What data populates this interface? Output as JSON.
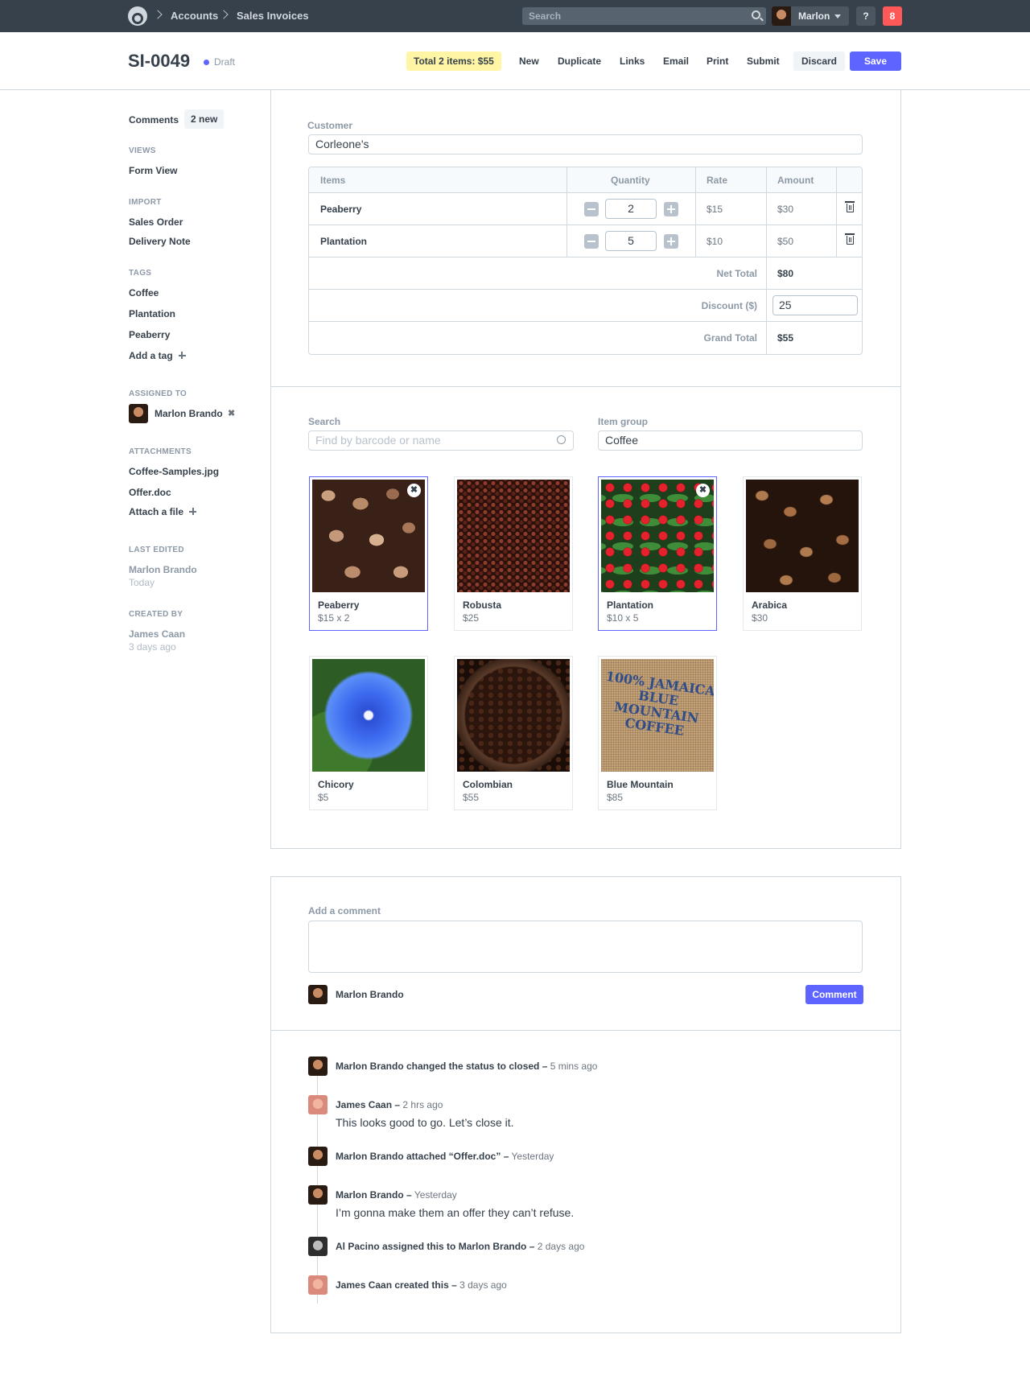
{
  "topnav": {
    "breadcrumbs": [
      "Accounts",
      "Sales Invoices"
    ],
    "search_placeholder": "Search",
    "user_name": "Marlon",
    "help_label": "?",
    "notification_count": "8"
  },
  "header": {
    "title": "SI-0049",
    "status": "Draft",
    "total_pill": "Total 2 items: $55",
    "actions": [
      "New",
      "Duplicate",
      "Links",
      "Email",
      "Print",
      "Submit"
    ],
    "discard_label": "Discard",
    "save_label": "Save"
  },
  "sidebar": {
    "comments_label": "Comments",
    "comments_badge": "2 new",
    "views_heading": "Views",
    "views": [
      "Form View"
    ],
    "import_heading": "Import",
    "imports": [
      "Sales Order",
      "Delivery Note"
    ],
    "tags_heading": "Tags",
    "tags": [
      "Coffee",
      "Plantation",
      "Peaberry"
    ],
    "add_tag_label": "Add a tag",
    "assigned_heading": "Assigned to",
    "assignee": "Marlon Brando",
    "attachments_heading": "Attachments",
    "attachments": [
      "Coffee-Samples.jpg",
      "Offer.doc"
    ],
    "attach_label": "Attach a file",
    "last_edited_heading": "Last edited",
    "last_edited_by": "Marlon Brando",
    "last_edited_when": "Today",
    "created_heading": "Created by",
    "created_by": "James Caan",
    "created_when": "3 days ago"
  },
  "form": {
    "customer_label": "Customer",
    "customer_value": "Corleone's",
    "columns": [
      "Items",
      "Quantity",
      "Rate",
      "Amount"
    ],
    "items": [
      {
        "name": "Peaberry",
        "qty": "2",
        "rate": "$15",
        "amount": "$30"
      },
      {
        "name": "Plantation",
        "qty": "5",
        "rate": "$10",
        "amount": "$50"
      }
    ],
    "net_total_label": "Net Total",
    "net_total": "$80",
    "discount_label": "Discount ($)",
    "discount": "25",
    "grand_total_label": "Grand Total",
    "grand_total": "$55"
  },
  "picker": {
    "search_label": "Search",
    "search_placeholder": "Find by barcode or name",
    "group_label": "Item group",
    "group_value": "Coffee",
    "products": [
      {
        "name": "Peaberry",
        "price": "$15 x 2",
        "selected": true
      },
      {
        "name": "Robusta",
        "price": "$25",
        "selected": false
      },
      {
        "name": "Plantation",
        "price": "$10 x 5",
        "selected": true
      },
      {
        "name": "Arabica",
        "price": "$30",
        "selected": false
      },
      {
        "name": "Chicory",
        "price": "$5",
        "selected": false
      },
      {
        "name": "Colombian",
        "price": "$55",
        "selected": false
      },
      {
        "name": "Blue Mountain",
        "price": "$85",
        "selected": false
      }
    ],
    "sack_text": "100% JAMAICA BLUE MOUNTAIN COFFEE"
  },
  "comments": {
    "add_label": "Add a comment",
    "author": "Marlon Brando",
    "button_label": "Comment",
    "timeline": [
      {
        "text": "Marlon Brando changed the status to closed –",
        "time": "5 mins ago",
        "body": ""
      },
      {
        "text": "James Caan –",
        "time": "2 hrs ago",
        "body": "This looks good to go. Let’s close it."
      },
      {
        "text": "Marlon Brando attached “Offer.doc” –",
        "time": "Yesterday",
        "body": ""
      },
      {
        "text": "Marlon Brando –",
        "time": "Yesterday",
        "body": "I’m gonna make them an offer they can’t refuse."
      },
      {
        "text": "Al Pacino assigned this to Marlon Brando –",
        "time": "2 days ago",
        "body": ""
      },
      {
        "text": "James Caan created this –",
        "time": "3 days ago",
        "body": ""
      }
    ]
  },
  "colors": {
    "nav_bg": "#36414c",
    "primary": "#5e64ff",
    "notification": "#ff5858",
    "highlight_pill": "#fff5a5",
    "border": "#d1d8dd",
    "muted_text": "#8d99a6"
  }
}
